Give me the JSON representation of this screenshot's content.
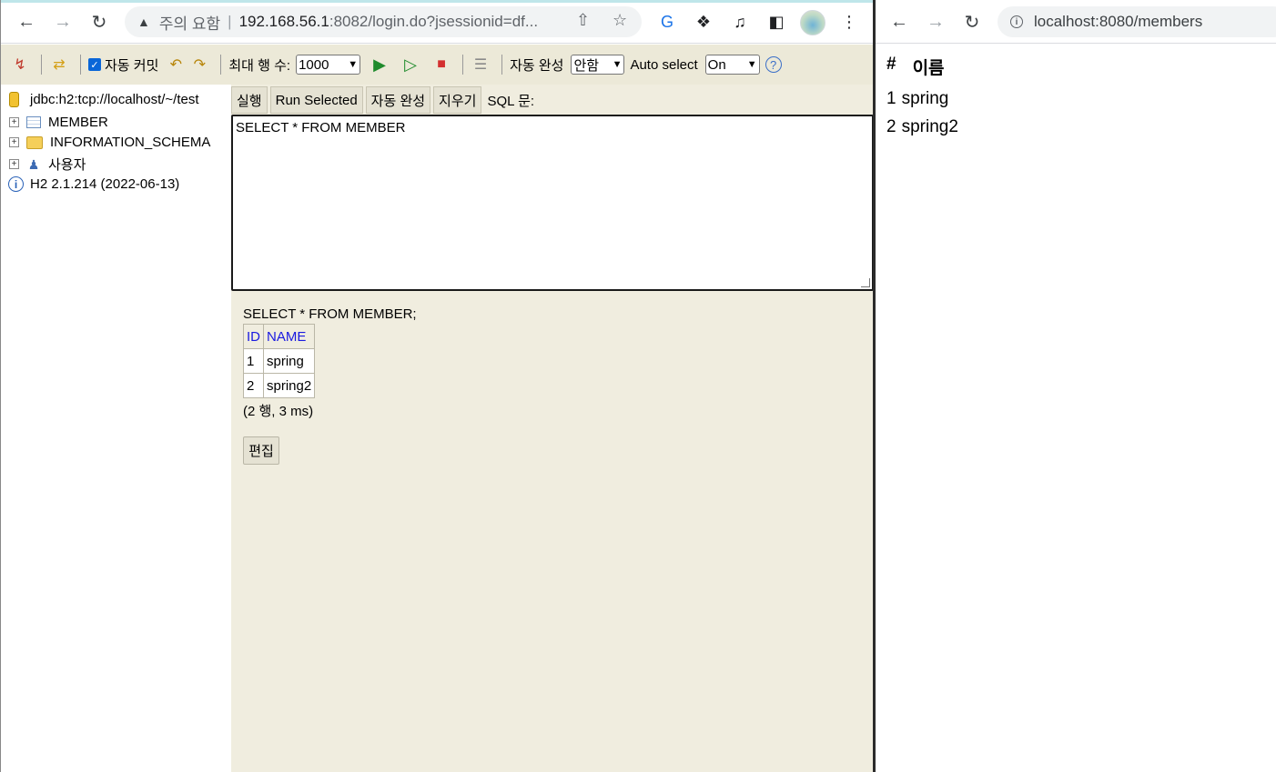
{
  "left_window": {
    "url_warning": "주의 요함",
    "url_host": "192.168.56.1",
    "url_rest": ":8082/login.do?jsessionid=df...",
    "toolbar": {
      "auto_commit_label": "자동 커밋",
      "max_rows_label": "최대 행 수:",
      "max_rows_value": "1000",
      "auto_complete_label": "자동 완성",
      "auto_complete_value": "안함",
      "auto_select_label": "Auto select",
      "auto_select_value": "On"
    },
    "tree": {
      "connection": "jdbc:h2:tcp://localhost/~/test",
      "items": [
        {
          "label": "MEMBER",
          "icon": "table-icon"
        },
        {
          "label": "INFORMATION_SCHEMA",
          "icon": "folder-icon"
        },
        {
          "label": "사용자",
          "icon": "users-icon"
        }
      ],
      "version": "H2 2.1.214 (2022-06-13)"
    },
    "commands": {
      "run": "실행",
      "run_selected": "Run Selected",
      "auto_complete": "자동 완성",
      "clear": "지우기",
      "sql_label": "SQL 문:"
    },
    "sql_text": "SELECT * FROM MEMBER",
    "result": {
      "query": "SELECT * FROM MEMBER;",
      "columns": [
        "ID",
        "NAME"
      ],
      "rows": [
        [
          "1",
          "spring"
        ],
        [
          "2",
          "spring2"
        ]
      ],
      "summary": "(2 행, 3 ms)",
      "edit_label": "편집"
    }
  },
  "right_window": {
    "url": "localhost:8080/members",
    "table": {
      "headers": [
        "#",
        "이름"
      ],
      "rows": [
        [
          "1",
          "spring"
        ],
        [
          "2",
          "spring2"
        ]
      ]
    }
  }
}
